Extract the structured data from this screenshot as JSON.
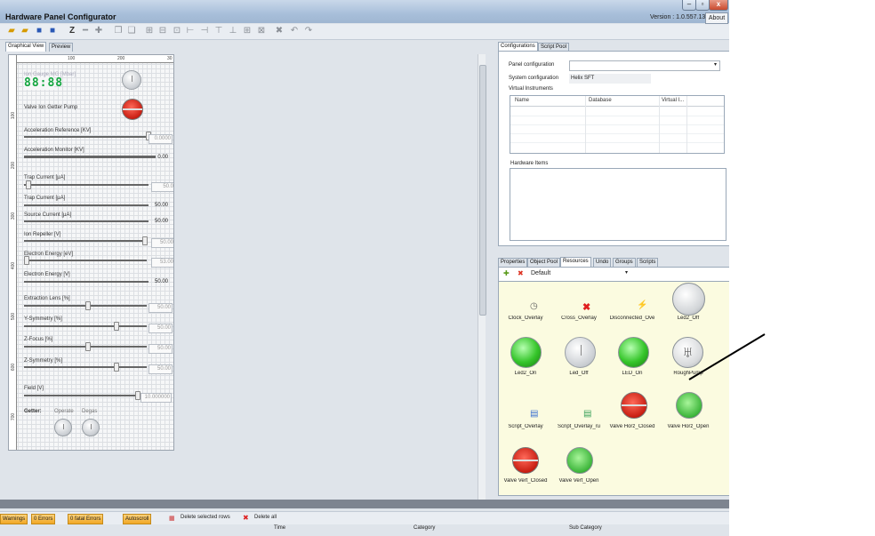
{
  "window": {
    "title": "Hardware Panel Configurator",
    "version": "Version : 1.0.557.13",
    "about_label": "About",
    "controls": [
      "–",
      "▫",
      "x"
    ]
  },
  "left_tabs": [
    "Graphical View",
    "Preview"
  ],
  "ruler": {
    "top": [
      "100",
      "200",
      "30"
    ],
    "left": [
      "100",
      "200",
      "300",
      "400",
      "500",
      "600",
      "700"
    ]
  },
  "instruments": {
    "ion_gauge_label": "Ion Gauge MG [Mbar]",
    "ion_gauge_value": "88:88",
    "valve_label": "Valve Ion Getter Pump",
    "sliders": [
      {
        "label": "Acceleration Reference [KV]",
        "value": "0.0000"
      },
      {
        "label": "Acceleration Monitor [KV]",
        "value": "0.00"
      },
      {
        "label": "Trap Current [µA]",
        "value": "50.0"
      },
      {
        "label": "Trap Current [µA]",
        "value": "50.00"
      },
      {
        "label": "Source Current [µA]",
        "value": "50.00"
      },
      {
        "label": "Ion Repeller [V]",
        "value": "50.00"
      },
      {
        "label": "Electron Energy [eV]",
        "value": "53.00"
      },
      {
        "label": "Electron Energy [V]",
        "value": "50.00"
      },
      {
        "label": "Extraction Lens [%]",
        "value": "50.00"
      },
      {
        "label": "Y-Symmetry [%]",
        "value": "50.00"
      },
      {
        "label": "Z-Focus [%]",
        "value": "50.00"
      },
      {
        "label": "Z-Symmetry [%]",
        "value": "50.00"
      },
      {
        "label": "Field [V]",
        "value": "10.000000"
      }
    ],
    "getter_label": "Getter:",
    "operate_label": "Operate",
    "degas_label": "Degas"
  },
  "config_panel": {
    "tabs": [
      "Configurations",
      "Script Pool"
    ],
    "panel_configuration_label": "Panel configuration",
    "system_configuration_label": "System configuration",
    "system_configuration_value": "Helix SFT",
    "virtual_instruments_label": "Virtual Instruments",
    "columns": [
      "Name",
      "Database",
      "Virtual I..."
    ],
    "hardware_items_label": "Hardware Items"
  },
  "resources_panel": {
    "tabs": [
      "Properties",
      "Object Pool",
      "Resources",
      "Undo",
      "Groups",
      "Scripts"
    ],
    "dropdown_value": "Default",
    "items": [
      {
        "label": "Clock_Overlay",
        "icon": "clock-icon"
      },
      {
        "label": "Cross_Overlay",
        "icon": "red-cross-icon"
      },
      {
        "label": "Disconnected_Ove",
        "icon": "plug-icon"
      },
      {
        "label": "Led2_Off",
        "icon": "led-off-icon"
      },
      {
        "label": "Led2_On",
        "icon": "led-green-icon"
      },
      {
        "label": "Led_Off",
        "icon": "power-off-icon"
      },
      {
        "label": "LED_On",
        "icon": "power-on-icon"
      },
      {
        "label": "RoughPump",
        "icon": "pump-icon"
      },
      {
        "label": "Script_Overlay",
        "icon": "script-icon"
      },
      {
        "label": "Script_Overlay_ru",
        "icon": "script-run-icon"
      },
      {
        "label": "Valve Horz_Closed",
        "icon": "valve-red-icon"
      },
      {
        "label": "Valve Horz_Open",
        "icon": "valve-green-icon"
      },
      {
        "label": "Valve Vert_Closed",
        "icon": "valve-vert-red-icon"
      },
      {
        "label": "Valve Vert_Open",
        "icon": "valve-vert-green-icon"
      }
    ]
  },
  "error_bar": {
    "warnings": "Warnings",
    "errors": "0 Errors",
    "fatal_errors": "0 fatal Errors",
    "autoscroll": "Autoscroll",
    "delete_selected": "Delete selected rows",
    "delete_all": "Delete all",
    "columns": [
      "Time",
      "Category",
      "Sub Category"
    ]
  }
}
